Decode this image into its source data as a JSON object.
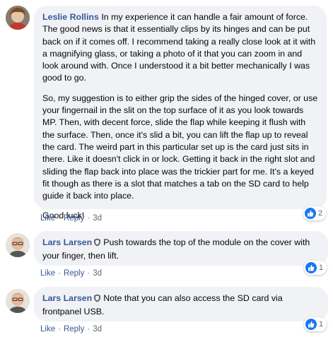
{
  "comments": [
    {
      "author": "Leslie Rollins",
      "paragraphs": [
        "In my experience it can handle a fair amount of force. The good news is that it essentially clips by its hinges and can be put back on if it comes off. I recommend taking a really close look at it with a magnifying glass, or taking a photo of it that you can zoom in and look around with. Once I understood it a bit better mechanically I was good to go.",
        "So, my suggestion is to either grip the sides of the hinged cover, or use your fingernail in the slit on the top surface of it as you look towards MP. Then, with decent force, slide the flap while keeping it flush with the surface. Then, once it's slid a bit, you can lift the flap up to reveal the card. The weird part in this particular set up is the card just sits in there. Like it doesn't click in or lock. Getting it back in the right slot and sliding the flap back into place was the trickier part for me. It's a keyed fit though as there is a slot that matches a tab on the SD card to help guide it back into place.",
        "Good luck!"
      ],
      "like_label": "Like",
      "reply_label": "Reply",
      "time": "3d",
      "reaction_count": "2",
      "reaction_icon": "like-icon"
    },
    {
      "author": "Lars Larsen",
      "badge_icon": "shield-badge-icon",
      "text": "Push towards the top of the module on the cover with your finger, then lift.",
      "like_label": "Like",
      "reply_label": "Reply",
      "time": "3d",
      "reaction_count": "1",
      "reaction_icon": "like-icon"
    },
    {
      "author": "Lars Larsen",
      "badge_icon": "shield-badge-icon",
      "text": "Note that you can also access the SD card via frontpanel USB.",
      "like_label": "Like",
      "reply_label": "Reply",
      "time": "3d",
      "reaction_count": "1",
      "reaction_icon": "like-icon"
    }
  ],
  "colors": {
    "author_link": "#385898",
    "bubble_bg": "#f0f2f5",
    "meta_text": "#65676b",
    "like_blue": "#1877f2"
  }
}
